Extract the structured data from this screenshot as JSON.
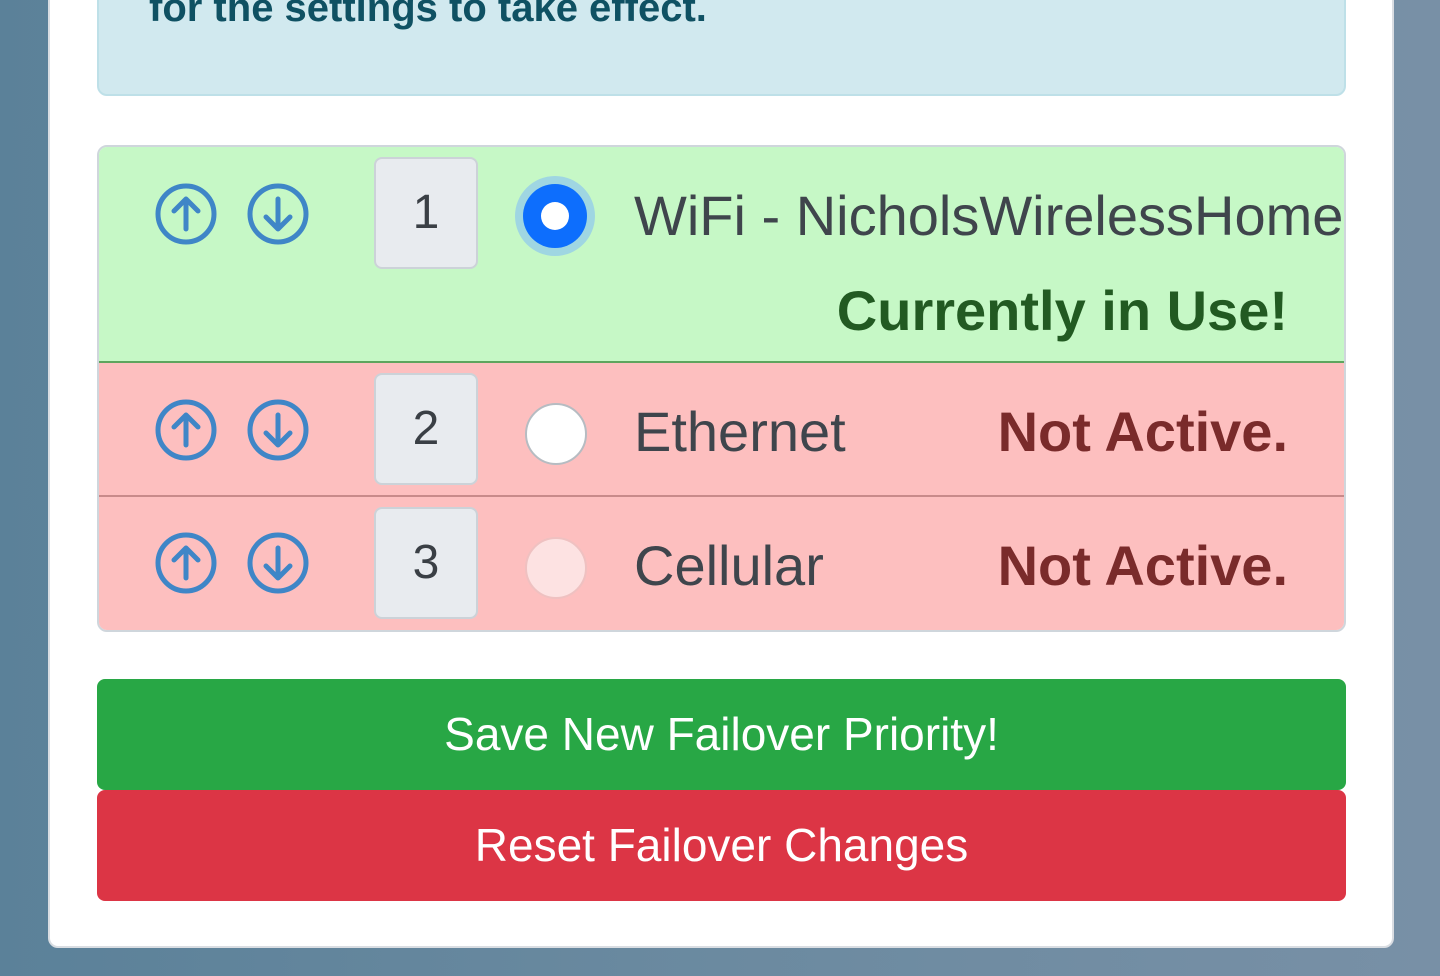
{
  "alert": {
    "text": "for the settings to take effect."
  },
  "connections": [
    {
      "priority": "1",
      "name": "WiFi - NicholsWirelessHome",
      "status": "Currently in Use!",
      "selected": true
    },
    {
      "priority": "2",
      "name": "Ethernet",
      "status": "Not Active.",
      "selected": false
    },
    {
      "priority": "3",
      "name": "Cellular",
      "status": "Not Active.",
      "selected": false
    }
  ],
  "buttons": {
    "save_label": "Save New Failover Priority!",
    "reset_label": "Reset Failover Changes"
  },
  "icons": {
    "up": "arrow-up-circle-icon",
    "down": "arrow-down-circle-icon"
  },
  "colors": {
    "active_row": "#c6f8c6",
    "inactive_row": "#fdbfbf",
    "save": "#28a745",
    "reset": "#dc3545",
    "radio_selected": "#0d6efd",
    "arrow": "#3f86c7"
  }
}
